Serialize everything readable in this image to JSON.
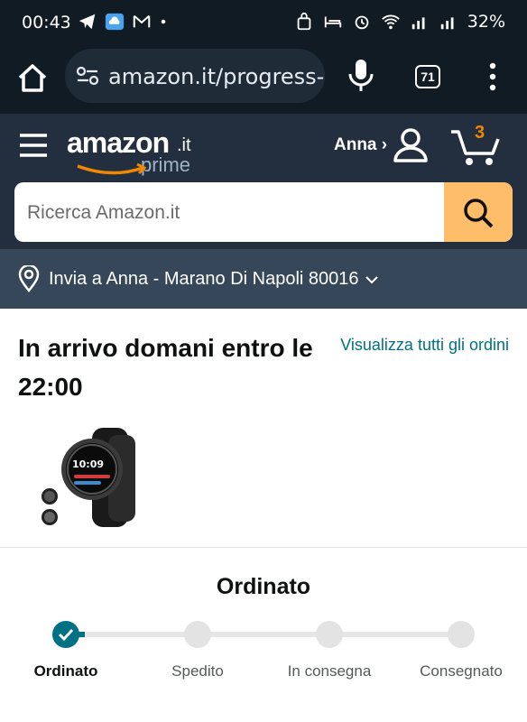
{
  "statusbar": {
    "time": "00:43",
    "battery": "32%"
  },
  "browser": {
    "url": "amazon.it/progress-t",
    "tab_count": "71"
  },
  "header": {
    "logo_word": "amazon",
    "logo_tld": ".it",
    "logo_prime": "prime",
    "account_label": "Anna ›",
    "cart_count": "3"
  },
  "search": {
    "placeholder": "Ricerca Amazon.it"
  },
  "delivery": {
    "text": "Invia a Anna - Marano Di Napoli 80016"
  },
  "order": {
    "arrival": "In arrivo domani entro le 22:00",
    "view_all": "Visualizza tutti gli ordini",
    "status_title": "Ordinato",
    "progress_completed_steps": 1,
    "steps": [
      {
        "label": "Ordinato",
        "done": true
      },
      {
        "label": "Spedito",
        "done": false
      },
      {
        "label": "In consegna",
        "done": false
      },
      {
        "label": "Consegnato",
        "done": false
      }
    ]
  },
  "product": {
    "watch_time": "10:09"
  },
  "colors": {
    "header_bg": "#232f3e",
    "deliver_bg": "#37475a",
    "search_btn": "#febd69",
    "accent": "#007185",
    "cart_orange": "#f08804"
  }
}
